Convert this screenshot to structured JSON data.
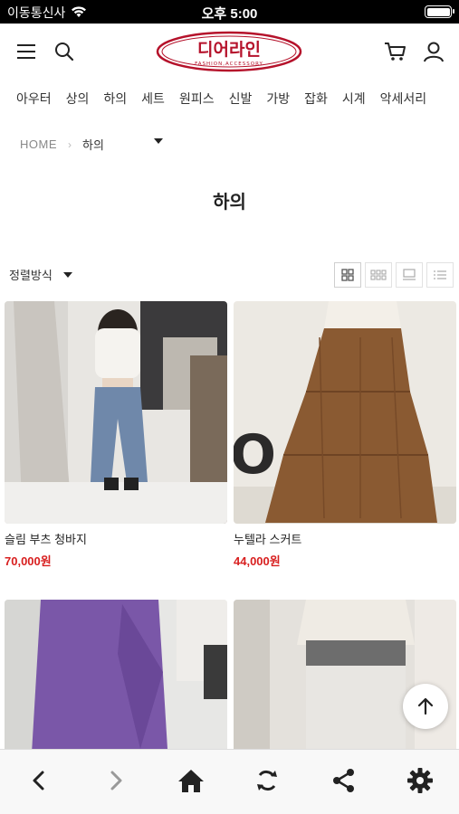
{
  "status_bar": {
    "carrier": "이동통신사",
    "time": "오후 5:00"
  },
  "header": {
    "logo_text": "디어라인",
    "logo_subtext": "FASHION,ACCESSORY",
    "icons": [
      "menu-icon",
      "search-icon",
      "cart-icon",
      "user-icon"
    ]
  },
  "categories": [
    "아우터",
    "상의",
    "하의",
    "세트",
    "원피스",
    "신발",
    "가방",
    "잡화",
    "시계",
    "악세서리"
  ],
  "breadcrumb": {
    "home": "HOME",
    "current": "하의"
  },
  "page_title": "하의",
  "sort": {
    "label": "정렬방식"
  },
  "products": [
    {
      "name": "슬림 부츠 청바지",
      "price": "70,000원"
    },
    {
      "name": "누텔라 스커트",
      "price": "44,000원"
    },
    {
      "name": "",
      "price": ""
    },
    {
      "name": "",
      "price": ""
    }
  ],
  "colors": {
    "price": "#d81f1f",
    "logo": "#b5122b"
  }
}
